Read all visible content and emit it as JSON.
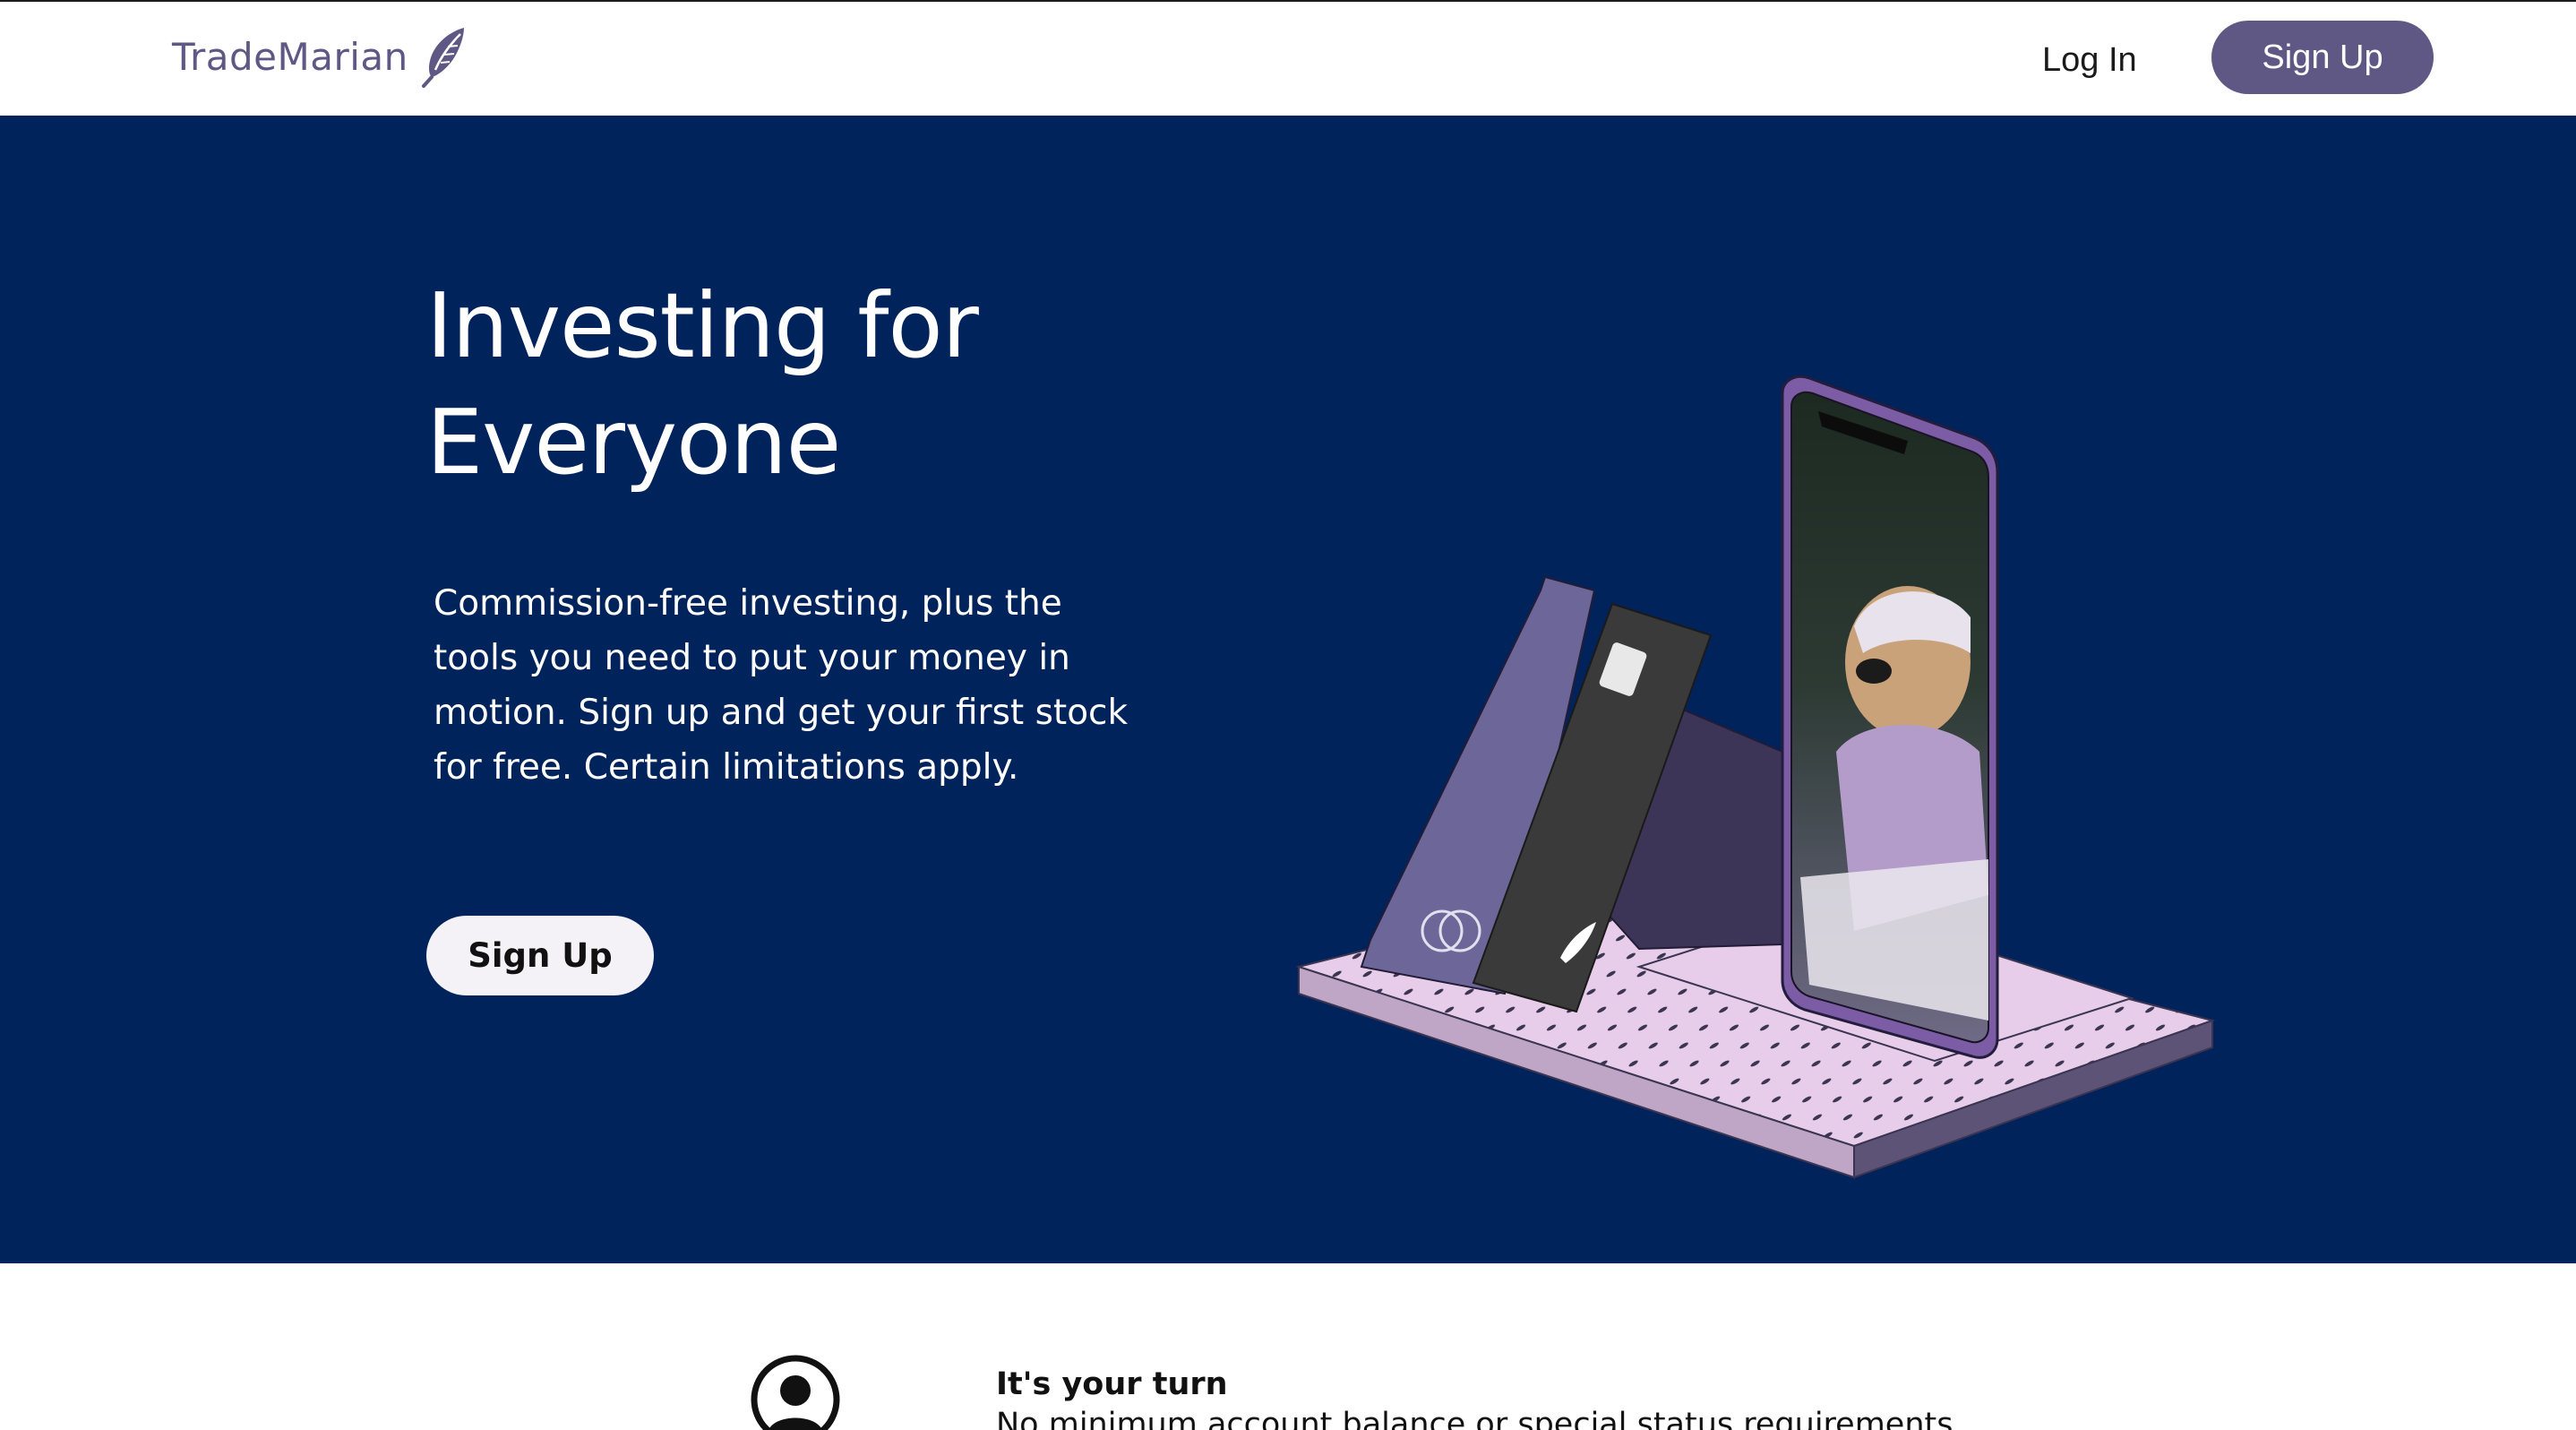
{
  "header": {
    "brand": "TradeMarian",
    "logo_icon": "feather-icon",
    "login_label": "Log In",
    "signup_label": "Sign Up",
    "accent_color": "#5f5884"
  },
  "hero": {
    "title_line1": "Investing for",
    "title_line2": "Everyone",
    "description": "Commission-free investing, plus the tools you need to put your money in motion. Sign up and get your first stock for free. Certain limitations apply.",
    "cta_label": "Sign Up",
    "background_color": "#00235c"
  },
  "features": {
    "icon": "user-circle-icon",
    "title": "It's your turn",
    "description": "No minimum account balance or special status requirements."
  }
}
